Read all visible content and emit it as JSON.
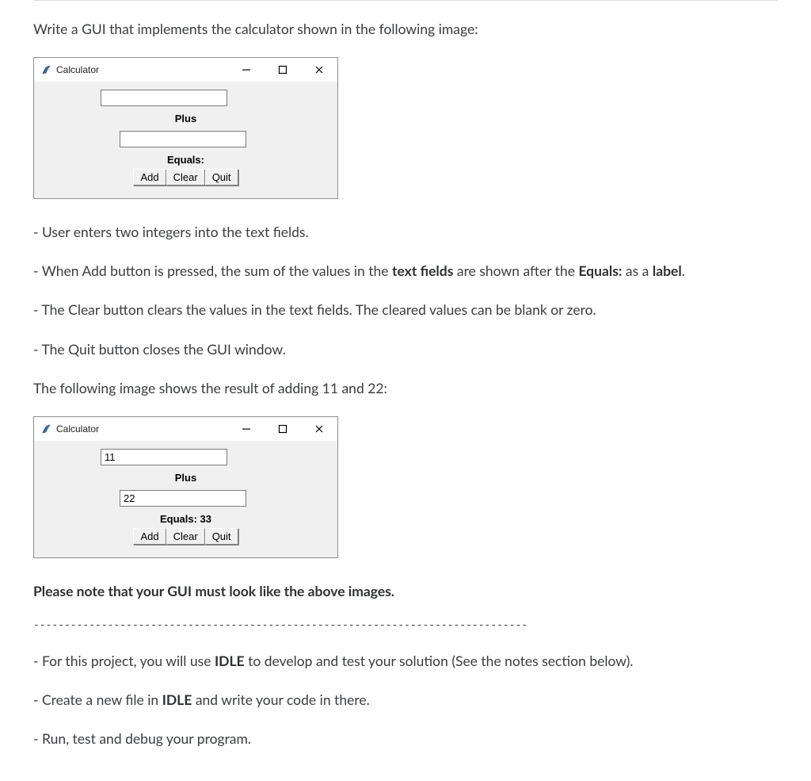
{
  "intro": "Write a GUI that implements the calculator shown in the following image:",
  "window1": {
    "title": "Calculator",
    "input1": "",
    "plus": "Plus",
    "input2": "",
    "equals": "Equals:",
    "buttons": {
      "add": "Add",
      "clear": "Clear",
      "quit": "Quit"
    }
  },
  "bullets1": [
    {
      "pre": "- User enters two integers into the text fields."
    },
    {
      "pre": "- When Add button is pressed, the sum of  the values in the ",
      "b1": "text fields",
      "mid": " are shown after the ",
      "b2": "Equals:",
      "mid2": " as a ",
      "b3": "label",
      "post": "."
    },
    {
      "pre": "- The Clear button clears the values in the text fields. The cleared values can be blank or zero."
    },
    {
      "pre": "- The Quit button closes the GUI window."
    }
  ],
  "result_intro": "The following image shows the result of adding 11 and 22:",
  "window2": {
    "title": "Calculator",
    "input1": "11",
    "plus": "Plus",
    "input2": "22",
    "equals": "Equals:  33",
    "buttons": {
      "add": "Add",
      "clear": "Clear",
      "quit": "Quit"
    }
  },
  "note": "Please note that your GUI must look like the above images.",
  "separator": "--------------------------------------------------------------------------------",
  "bullets2_line1": {
    "pre": "- For this project, you will use ",
    "b": "IDLE",
    "post": " to develop and test your solution (See the notes section below)."
  },
  "bullets2_line2": {
    "pre": "- Create a new file in  ",
    "b": "IDLE",
    "post": "  and write your code in there."
  },
  "bullets2_line3": "- Run, test and debug your program."
}
